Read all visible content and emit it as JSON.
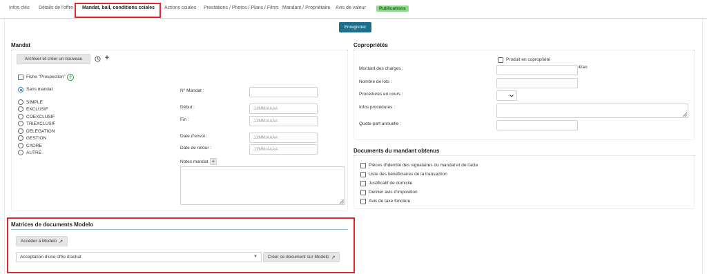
{
  "tabs": [
    {
      "label": "Infos clés"
    },
    {
      "label": "Détails de l'offre"
    },
    {
      "label": "Mandat, bail, conditions cciales",
      "active": true
    },
    {
      "label": "Actions cciales"
    },
    {
      "label": "Prestations / Photos / Plans / Films"
    },
    {
      "label": "Mandant / Propriétaire"
    },
    {
      "label": "Avis de valeur"
    },
    {
      "label": "Publications",
      "badge": true
    }
  ],
  "toolbar": {
    "save_label": "Enregistrer"
  },
  "mandat": {
    "title": "Mandat",
    "archive_button": "Archiver et créer un nouveau",
    "prospection_label": "Fiche \"Prospection\"",
    "help_glyph": "?",
    "types": [
      {
        "label": "Sans mandat",
        "checked": true
      },
      {
        "label": "SIMPLE"
      },
      {
        "label": "EXCLUSIF"
      },
      {
        "label": "COEXCLUSIF"
      },
      {
        "label": "TRIEXCLUSIF"
      },
      {
        "label": "DELEGATION"
      },
      {
        "label": "GESTION"
      },
      {
        "label": "CADRE"
      },
      {
        "label": "AUTRE"
      }
    ],
    "fields": {
      "numero_label": "N° Mandat :",
      "debut_label": "Début :",
      "fin_label": "Fin :",
      "envoi_label": "Date d'envoi :",
      "retour_label": "Date de retour :",
      "notes_label": "Notes mandat",
      "date_placeholder": "JJ/MM/AAAA"
    }
  },
  "copro": {
    "title": "Copropriétés",
    "produit_label": "Produit en copropriété",
    "charges_label": "Montant des charges :",
    "charges_unit": "€/an",
    "lots_label": "Nombre de lots :",
    "procedures_label": "Procédures en cours :",
    "infos_label": "Infos procédures :",
    "quote_label": "Quote-part annuelle :"
  },
  "documents": {
    "title": "Documents du mandant obtenus",
    "items": [
      "Pièces d'identité des signataires du mandat et de l'acte",
      "Liste des bénéficiaires de la transaction",
      "Justificatif de domicile",
      "Dernier avis d'imposition",
      "Avis de taxe foncière"
    ]
  },
  "modelo": {
    "title": "Matrices de documents Modelo",
    "access_button": "Accéder à Modelo",
    "select_value": "Acceptation d'une offre d'achat",
    "create_button": "Créer ce document sur Modelo"
  },
  "colors": {
    "accent": "#1e6e8c",
    "highlight_box": "#e3262e",
    "badge": "#8fd98f"
  }
}
